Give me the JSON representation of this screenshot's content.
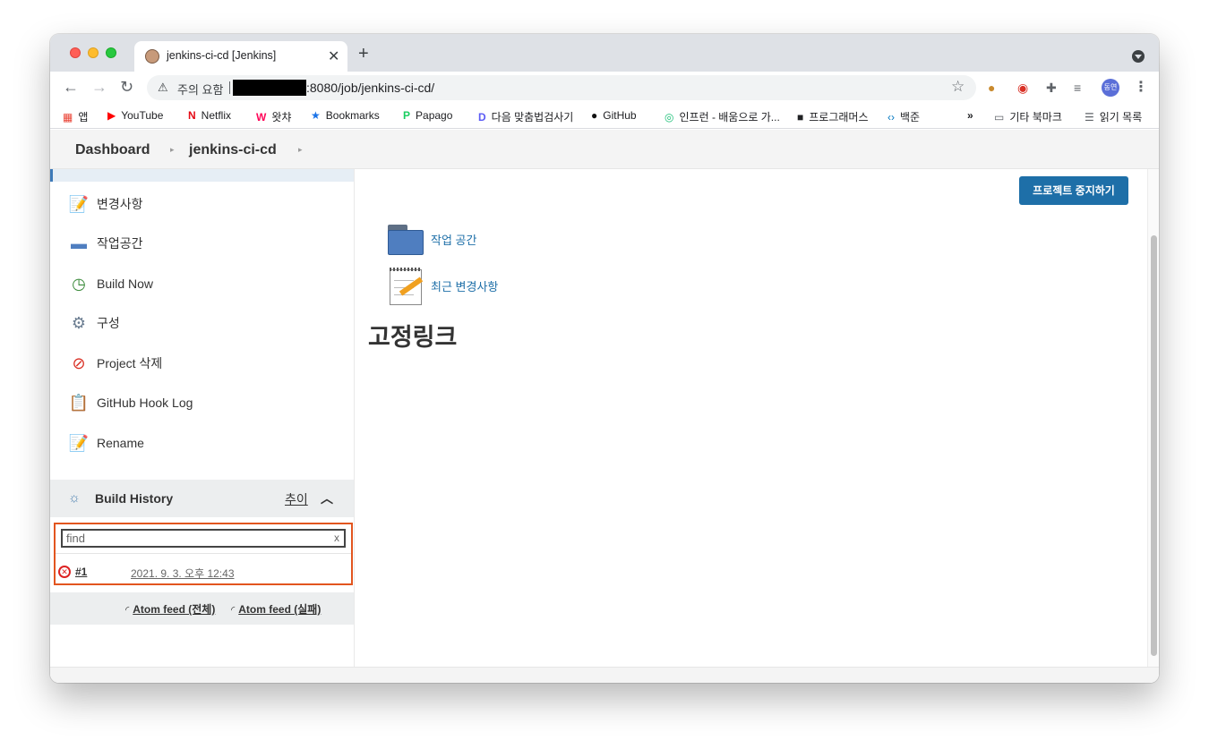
{
  "browser": {
    "tab_title": "jenkins-ci-cd [Jenkins]",
    "tab_close": "✕",
    "new_tab": "+",
    "security_warning": "주의 요함",
    "url_suffix": ":8080/job/jenkins-ci-cd/",
    "profile_initials": "동연"
  },
  "bookmarks": {
    "apps": "앱",
    "youtube": "YouTube",
    "netflix": "Netflix",
    "watcha": "왓챠",
    "bookmarks": "Bookmarks",
    "papago": "Papago",
    "daum": "다음 맞춤법검사기",
    "github": "GitHub",
    "inflearn": "인프런 - 배움으로 가...",
    "programmers": "프로그래머스",
    "baekjoon": "백준",
    "more": "»",
    "other": "기타 북마크",
    "reading_list": "읽기 목록"
  },
  "breadcrumb": {
    "dashboard": "Dashboard",
    "job": "jenkins-ci-cd"
  },
  "sidebar": {
    "tasks": [
      {
        "label": "변경사항"
      },
      {
        "label": "작업공간"
      },
      {
        "label": "Build Now"
      },
      {
        "label": "구성"
      },
      {
        "label": "Project 삭제"
      },
      {
        "label": "GitHub Hook Log"
      },
      {
        "label": "Rename"
      }
    ]
  },
  "build_history": {
    "title": "Build History",
    "trend": "추이",
    "find_value": "find",
    "find_clear": "x",
    "builds": [
      {
        "number": "#1",
        "date": "2021. 9. 3. 오후 12:43",
        "status": "failed"
      }
    ],
    "feed_all": "Atom feed (전체)",
    "feed_failed": "Atom feed (실패)"
  },
  "main": {
    "stop_button": "프로젝트 중지하기",
    "workspace_link": "작업 공간",
    "recent_changes_link": "최근 변경사항",
    "permalinks_title": "고정링크"
  },
  "colors": {
    "accent": "#1e6fa8",
    "highlight_border": "#e2551f",
    "failed": "#dd2222"
  }
}
